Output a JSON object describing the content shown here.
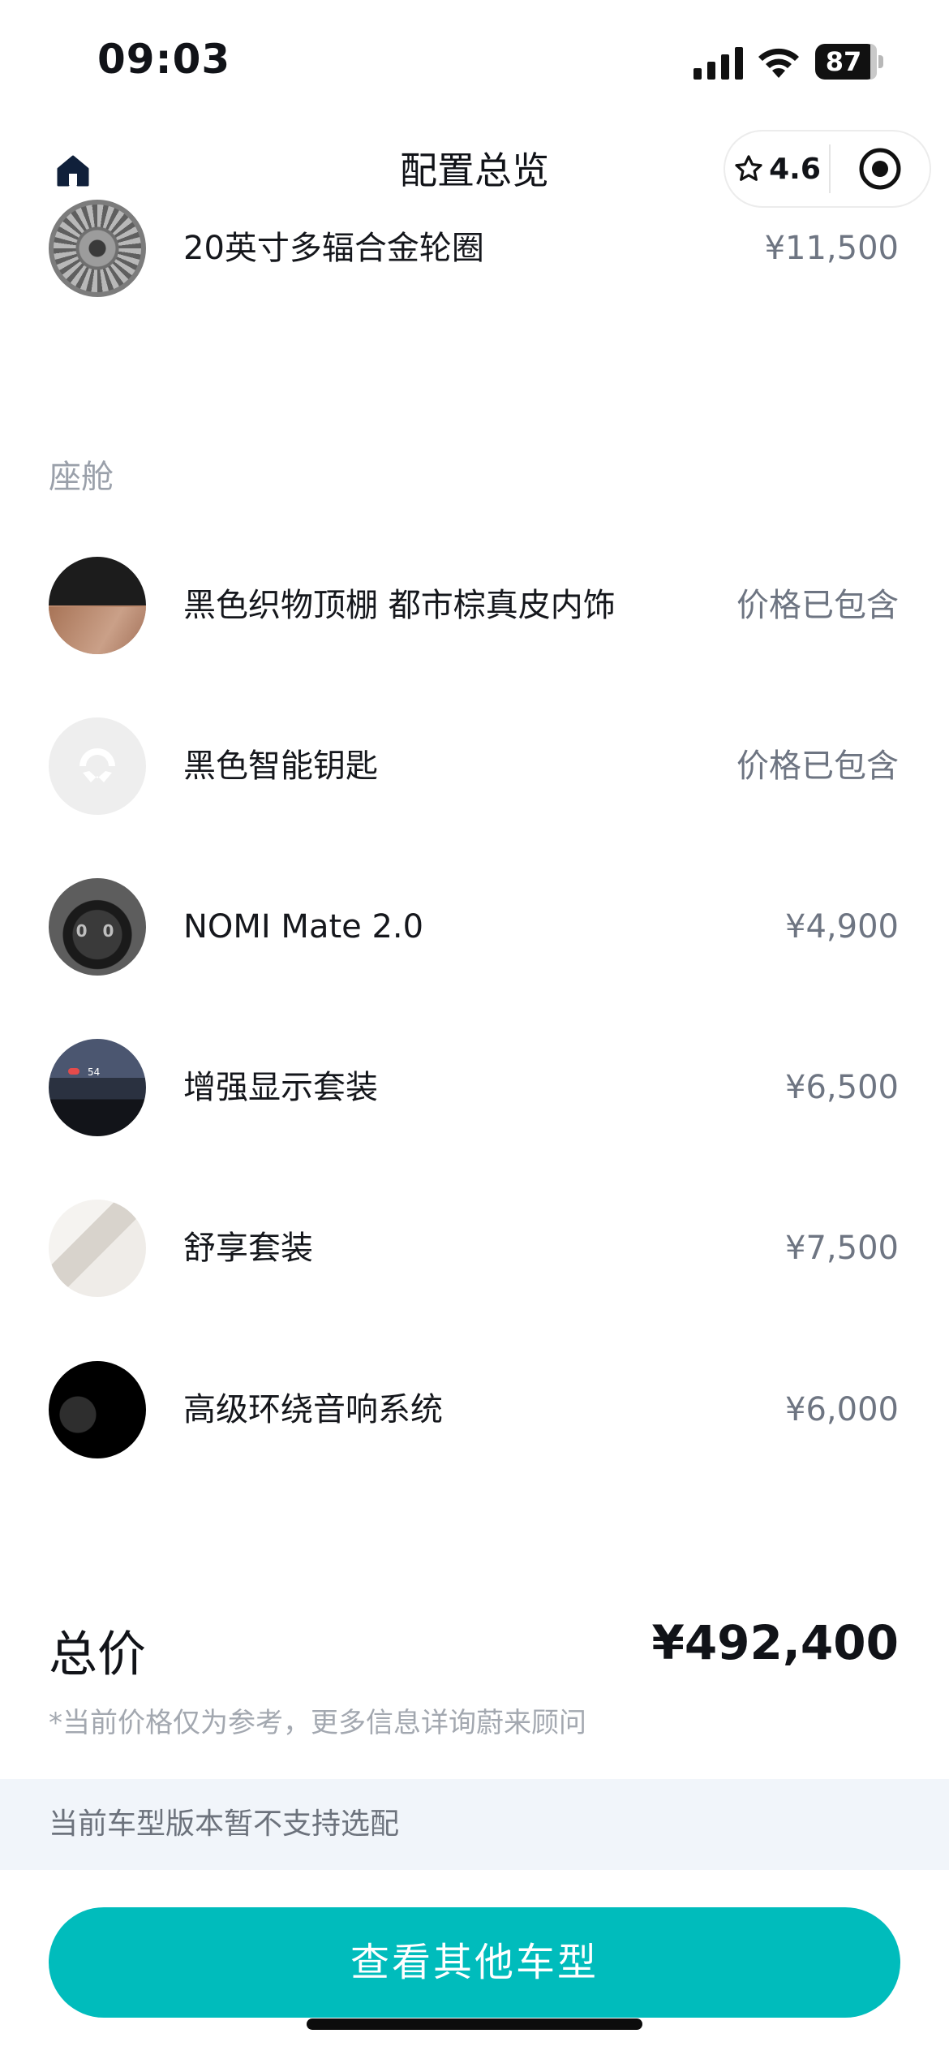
{
  "status_bar": {
    "time": "09:03",
    "battery": "87"
  },
  "nav": {
    "title": "配置总览",
    "rating": "4.6"
  },
  "wheel_option": {
    "name": "20英寸多辐合金轮圈",
    "price": "¥11,500"
  },
  "cabin": {
    "section_title": "座舱",
    "items": [
      {
        "name": "黑色织物顶棚 都市棕真皮内饰",
        "price": "价格已包含",
        "thumb": "interior-thumb"
      },
      {
        "name": "黑色智能钥匙",
        "price": "价格已包含",
        "thumb": "smart-key-thumb"
      },
      {
        "name": "NOMI Mate 2.0",
        "price": "¥4,900",
        "thumb": "nomi-thumb"
      },
      {
        "name": "增强显示套装",
        "price": "¥6,500",
        "thumb": "hud-thumb"
      },
      {
        "name": "舒享套装",
        "price": "¥7,500",
        "thumb": "seat-thumb"
      },
      {
        "name": "高级环绕音响系统",
        "price": "¥6,000",
        "thumb": "audio-thumb"
      }
    ]
  },
  "total": {
    "label": "总价",
    "value": "¥492,400",
    "disclaimer": "*当前价格仅为参考，更多信息详询蔚来顾问"
  },
  "notice": "当前车型版本暂不支持选配",
  "cta_label": "查看其他车型",
  "colors": {
    "accent": "#00bcbc",
    "notice_bg": "#f1f5fa",
    "price_gray": "#6e7582"
  }
}
